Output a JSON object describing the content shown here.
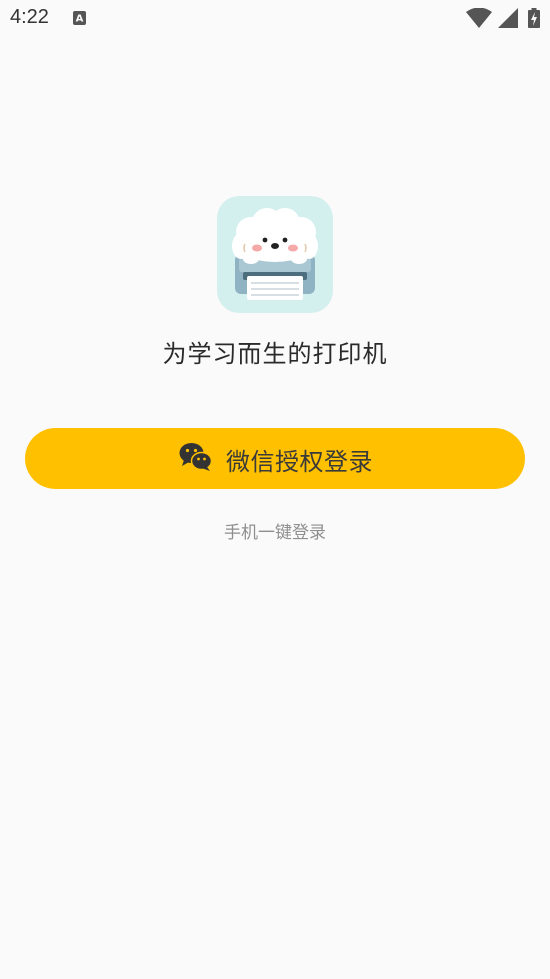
{
  "status_bar": {
    "time": "4:22",
    "notification_icon": "a-notification-icon",
    "wifi_icon": "wifi-icon",
    "signal_icon": "cell-signal-icon",
    "battery_icon": "battery-charging-icon"
  },
  "app": {
    "logo_icon": "dog-printer-logo",
    "slogan": "为学习而生的打印机"
  },
  "login": {
    "wechat_button_label": "微信授权登录",
    "wechat_icon": "wechat-icon",
    "phone_login_label": "手机一键登录"
  },
  "colors": {
    "accent": "#ffc000",
    "background": "#fafafa",
    "logo_background": "#d3f0ef"
  }
}
